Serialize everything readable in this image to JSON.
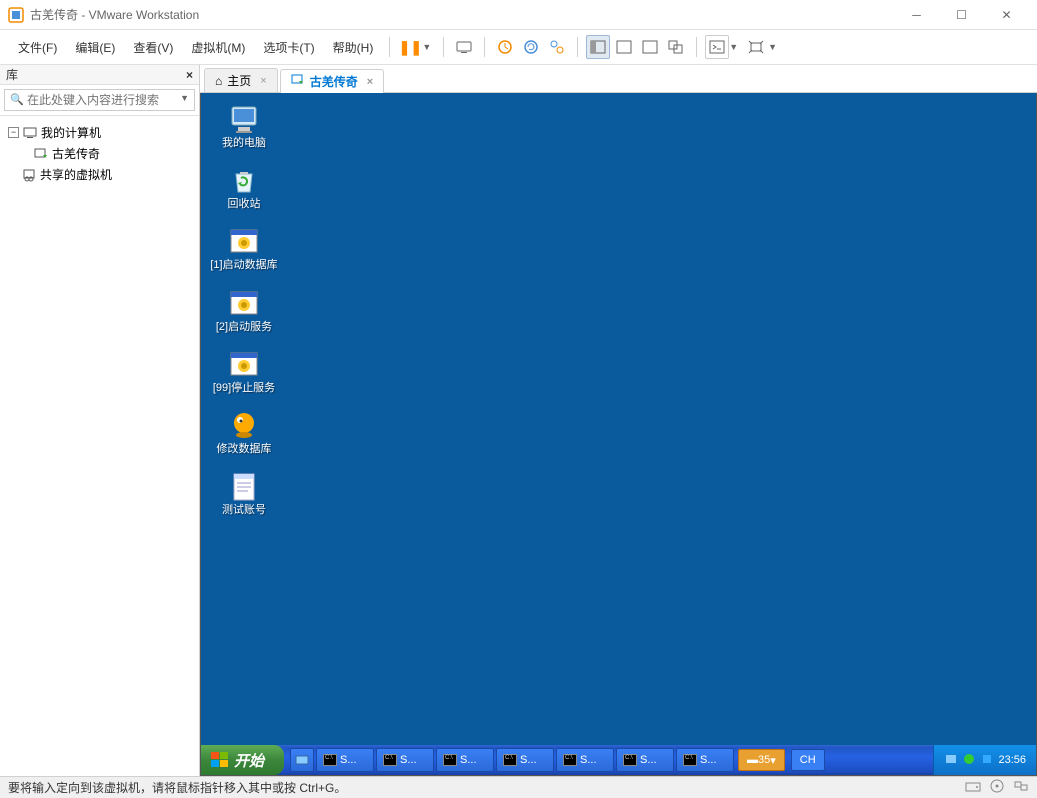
{
  "window": {
    "title": "古羌传奇 - VMware Workstation"
  },
  "menu": {
    "file": "文件(F)",
    "edit": "编辑(E)",
    "view": "查看(V)",
    "vm": "虚拟机(M)",
    "tabs": "选项卡(T)",
    "help": "帮助(H)"
  },
  "library": {
    "title": "库",
    "search_placeholder": "在此处键入内容进行搜索",
    "items": [
      {
        "label": "我的计算机",
        "expanded": true
      },
      {
        "label": "古羌传奇"
      },
      {
        "label": "共享的虚拟机"
      }
    ]
  },
  "tabs": {
    "home": "主页",
    "active": "古羌传奇"
  },
  "desktop_icons": [
    {
      "label": "我的电脑",
      "type": "computer"
    },
    {
      "label": "回收站",
      "type": "recycle"
    },
    {
      "label": "[1]启动数据库",
      "type": "bat"
    },
    {
      "label": "[2]启动服务",
      "type": "bat"
    },
    {
      "label": "[99]停止服务",
      "type": "bat"
    },
    {
      "label": "修改数据库",
      "type": "orange"
    },
    {
      "label": "测试账号",
      "type": "notepad"
    }
  ],
  "xp": {
    "start": "开始",
    "task_label": "S...",
    "lang_num": "35",
    "lang_ch": "CH",
    "clock": "23:56"
  },
  "status": {
    "hint": "要将输入定向到该虚拟机，请将鼠标指针移入其中或按 Ctrl+G。"
  }
}
